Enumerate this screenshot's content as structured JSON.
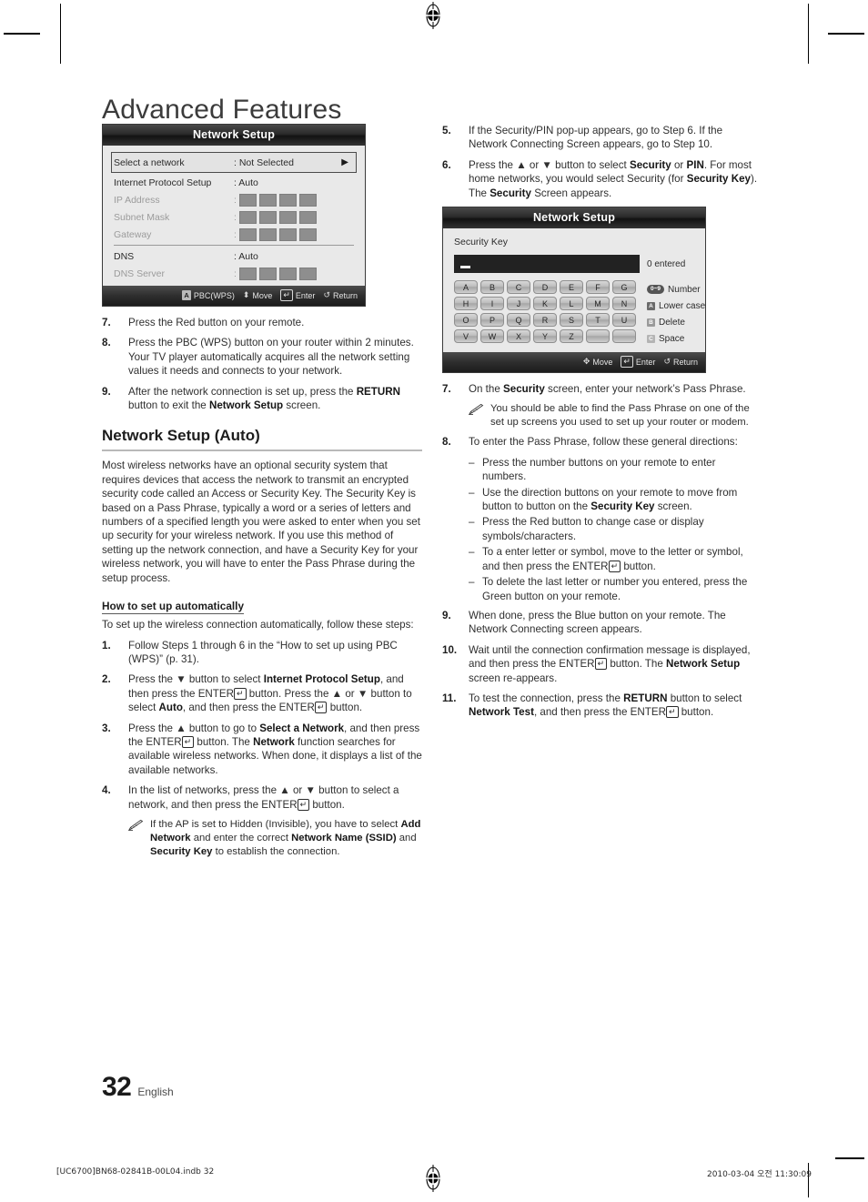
{
  "page": {
    "title": "Advanced Features",
    "number": "32",
    "language": "English",
    "colophon": "[UC6700]BN68-02841B-00L04.indb   32",
    "timestamp": "2010-03-04   오전 11:30:09"
  },
  "osd_network_setup": {
    "title": "Network Setup",
    "rows": [
      {
        "label": "Select a network",
        "value": ": Not Selected",
        "arrow": "▶",
        "state": "selected"
      },
      {
        "label": "Internet Protocol Setup",
        "value": ": Auto",
        "state": "normal"
      },
      {
        "label": "IP Address",
        "value": ":",
        "boxes": 4,
        "state": "dim"
      },
      {
        "label": "Subnet Mask",
        "value": ":",
        "boxes": 4,
        "state": "dim"
      },
      {
        "label": "Gateway",
        "value": ":",
        "boxes": 4,
        "state": "dim"
      },
      {
        "label": "DNS",
        "value": ": Auto",
        "state": "normal",
        "separator_before": true
      },
      {
        "label": "DNS Server",
        "value": ":",
        "boxes": 4,
        "state": "dim"
      }
    ],
    "footer": [
      {
        "key": "A",
        "key_style": "cap",
        "label": "PBC(WPS)"
      },
      {
        "key": "⬍",
        "key_style": "glyph",
        "label": "Move"
      },
      {
        "key": "↵",
        "key_style": "enter",
        "label": "Enter"
      },
      {
        "key": "↺",
        "key_style": "glyph",
        "label": "Return"
      }
    ]
  },
  "osd_security_key": {
    "title": "Network Setup",
    "field_label": "Security Key",
    "entry_value": "",
    "entered_count_label": "0 entered",
    "keyboard_rows": [
      [
        "A",
        "B",
        "C",
        "D",
        "E",
        "F",
        "G"
      ],
      [
        "H",
        "I",
        "J",
        "K",
        "L",
        "M",
        "N"
      ],
      [
        "O",
        "P",
        "Q",
        "R",
        "S",
        "T",
        "U"
      ],
      [
        "V",
        "W",
        "X",
        "Y",
        "Z",
        "",
        ""
      ]
    ],
    "legend": [
      {
        "key": "0~9",
        "key_style": "pill",
        "label": "Number"
      },
      {
        "key": "A",
        "key_style": "a",
        "label": "Lower case"
      },
      {
        "key": "B",
        "key_style": "b",
        "label": "Delete"
      },
      {
        "key": "C",
        "key_style": "c",
        "label": "Space"
      }
    ],
    "footer": [
      {
        "key": "✥",
        "key_style": "glyph",
        "label": "Move"
      },
      {
        "key": "↵",
        "key_style": "enter",
        "label": "Enter"
      },
      {
        "key": "↺",
        "key_style": "glyph",
        "label": "Return"
      }
    ]
  },
  "left_column": {
    "steps_top": [
      {
        "num": "7.",
        "html": "Press the Red button on your remote."
      },
      {
        "num": "8.",
        "html": "Press the PBC (WPS) button on your router within 2 minutes. Your TV player automatically acquires all the network setting values it needs and connects to your network."
      },
      {
        "num": "9.",
        "html": "After the network connection is set up, press the <b>RETURN</b> button to exit the <b>Network Setup</b> screen."
      }
    ],
    "section_heading": "Network Setup (Auto)",
    "paragraph": "Most wireless networks have an optional security system that requires devices that access the network to transmit an encrypted security code called an Access or Security Key. The Security Key is based on a Pass Phrase, typically a word or a series of letters and numbers of a specified length you were asked to enter when you set up security for your wireless network. If you use this method of setting up the network connection, and have a Security Key for your wireless network, you will have to enter the Pass Phrase during the setup process.",
    "subsection_heading": "How to set up automatically",
    "lead": "To set up the wireless connection automatically, follow these steps:",
    "steps": [
      {
        "num": "1.",
        "html": "Follow Steps 1 through 6 in the “How to set up using PBC (WPS)” (p. 31)."
      },
      {
        "num": "2.",
        "html": "Press the ▼ button to select <b>Internet Protocol Setup</b>, and then press the ENTER<span class=\"enter-ico\">↵</span> button. Press the ▲ or ▼ button to select <b>Auto</b>, and then press the ENTER<span class=\"enter-ico\">↵</span> button."
      },
      {
        "num": "3.",
        "html": "Press the ▲ button to go to <b>Select a Network</b>, and then press the ENTER<span class=\"enter-ico\">↵</span> button. The <b>Network</b> function searches for available wireless networks. When done, it displays a list of the available networks."
      },
      {
        "num": "4.",
        "html": "In the list of networks, press the ▲ or ▼ button to select a network, and then press the ENTER<span class=\"enter-ico\">↵</span> button."
      }
    ],
    "note": "If the AP is set to Hidden (Invisible), you have to select <b>Add Network</b> and enter the correct <b>Network Name (SSID)</b> and <b>Security Key</b> to establish the connection."
  },
  "right_column": {
    "steps_top": [
      {
        "num": "5.",
        "html": "If the Security/PIN pop-up appears, go to Step 6. If the Network Connecting Screen appears, go to Step 10."
      },
      {
        "num": "6.",
        "html": "Press the ▲ or ▼ button to select <b>Security</b> or <b>PIN</b>. For most home networks, you would select Security (for <b>Security Key</b>). The <b>Security</b> Screen appears."
      }
    ],
    "step7": {
      "num": "7.",
      "html": "On the <b>Security</b> screen, enter your network’s Pass Phrase."
    },
    "note7": "You should be able to find the Pass Phrase on one of the set up screens you used to set up your router or modem.",
    "step8": {
      "num": "8.",
      "html": "To enter the Pass Phrase, follow these general directions:"
    },
    "bullets": [
      "Press the number buttons on your remote to enter numbers.",
      "Use the direction buttons on your remote to move from button to button on the <b>Security Key</b> screen.",
      "Press the Red button to change case or display symbols/characters.",
      "To a enter letter or symbol, move to the letter or symbol, and then press the ENTER<span class=\"enter-ico\">↵</span> button.",
      "To delete the last letter or number you entered, press the Green button on your remote."
    ],
    "steps_bottom": [
      {
        "num": "9.",
        "html": "When done, press the Blue button on your remote. The Network Connecting screen appears."
      },
      {
        "num": "10.",
        "html": "Wait until the connection confirmation message is displayed, and then press the ENTER<span class=\"enter-ico\">↵</span> button. The <b>Network Setup</b> screen re-appears."
      },
      {
        "num": "11.",
        "html": "To test the connection, press the <b>RETURN</b> button to select <b>Network Test</b>, and then press the ENTER<span class=\"enter-ico\">↵</span> button."
      }
    ]
  }
}
